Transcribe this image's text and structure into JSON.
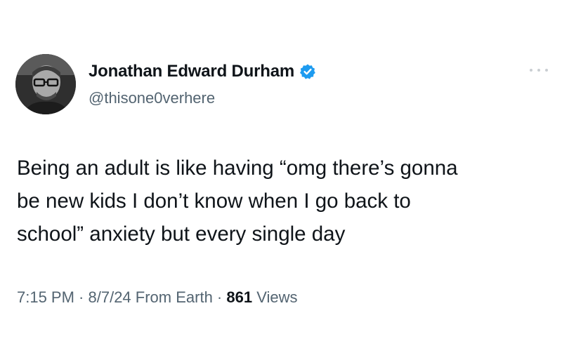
{
  "tweet": {
    "author": {
      "display_name": "Jonathan Edward Durham",
      "handle": "@thisone0verhere",
      "verified": true,
      "verified_color": "#1d9bf0"
    },
    "more_menu_icon": "more-dots-icon",
    "text": "Being an adult is like having “omg there’s gonna\nbe new kids I don’t know when I go back to\nschool” anxiety but every single day",
    "meta": {
      "time": "7:15 PM",
      "sep1": " · ",
      "date": "8/7/24",
      "source": " From Earth",
      "sep2": " · ",
      "views_count": "861",
      "views_label": " Views"
    }
  }
}
